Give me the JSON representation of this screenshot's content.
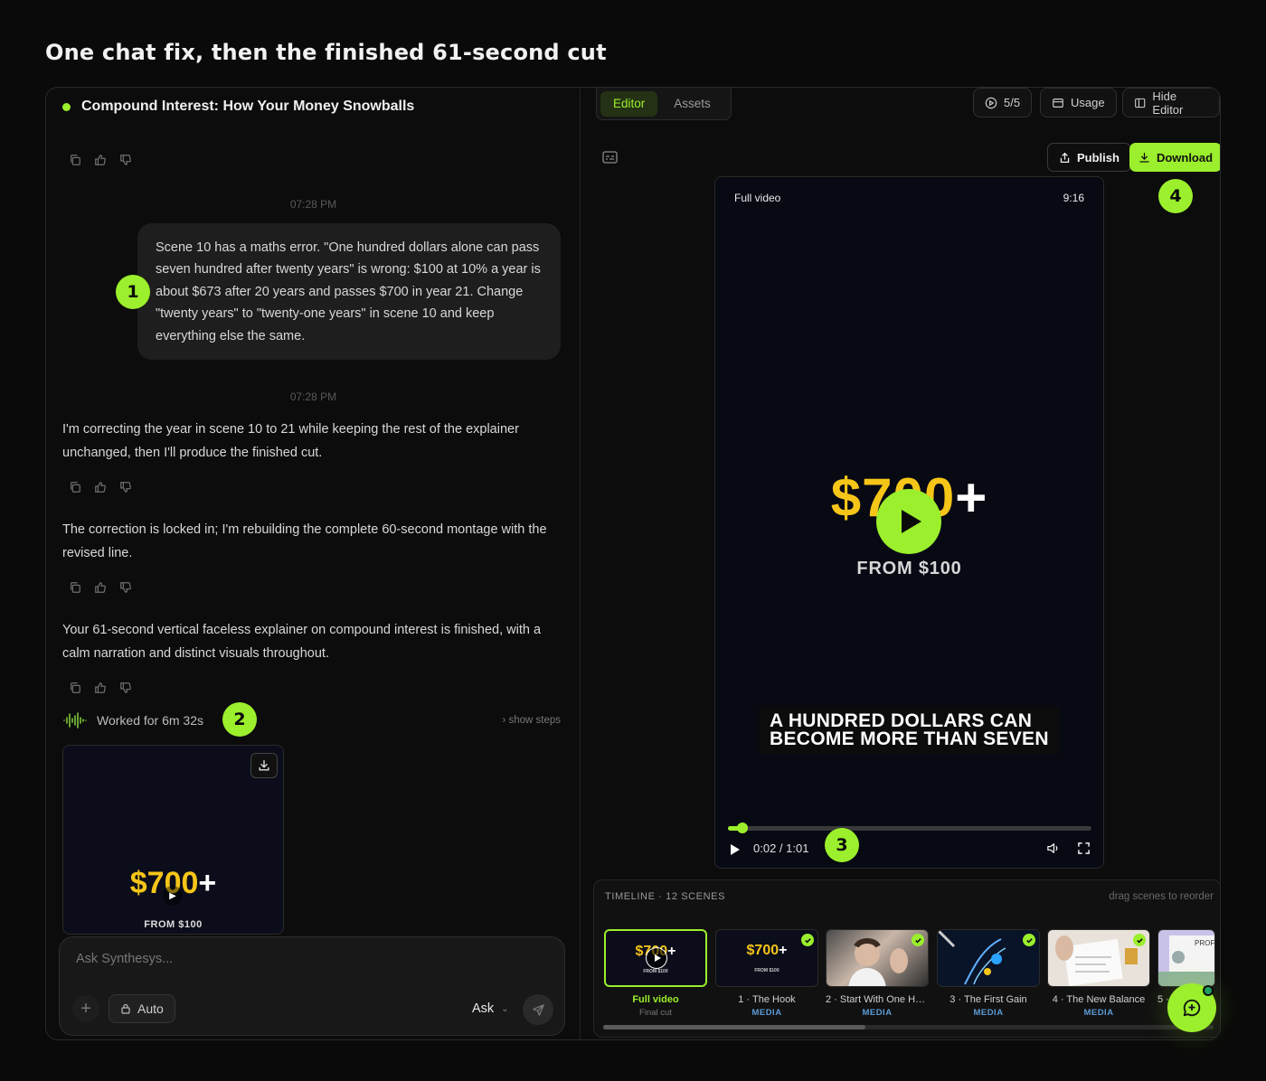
{
  "heading": "One chat fix, then the finished 61-second cut",
  "chat": {
    "project_title": "Compound Interest: How Your Money Snowballs",
    "timestamp_1": "07:28 PM",
    "user_message": "Scene 10 has a maths error. \"One hundred dollars alone can pass seven hundred after twenty years\" is wrong: $100 at 10% a year is about $673 after 20 years and passes $700 in year 21. Change \"twenty years\" to \"twenty-one years\" in scene 10 and keep everything else the same.",
    "timestamp_2": "07:28 PM",
    "assistant_1": "I'm correcting the year in scene 10 to 21 while keeping the rest of the explainer unchanged, then I'll produce the finished cut.",
    "assistant_2": "The correction is locked in; I'm rebuilding the complete 60-second montage with the revised line.",
    "assistant_3": "Your 61-second vertical faceless explainer on compound interest is finished, with a calm narration and distinct visuals throughout.",
    "worked_for": "Worked for 6m 32s",
    "show_steps": "› show steps",
    "thumb_amount": "$700",
    "thumb_plus": "+",
    "thumb_from": "FROM $100",
    "composer": {
      "placeholder": "Ask Synthesys...",
      "plus": "+",
      "auto_label": "Auto",
      "mode_label": "Ask"
    }
  },
  "badges": {
    "b1": "1",
    "b2": "2",
    "b3": "3",
    "b4": "4"
  },
  "editor": {
    "tabs": [
      "Editor",
      "Assets"
    ],
    "credits": "5/5",
    "usage_label": "Usage",
    "hide_editor_label": "Hide Editor",
    "publish_label": "Publish",
    "download_label": "Download",
    "player": {
      "label": "Full video",
      "ratio": "9:16",
      "amount": "$700",
      "plus": "+",
      "from": "FROM $100",
      "caption_line1": "A HUNDRED DOLLARS CAN",
      "caption_line2": "BECOME MORE THAN SEVEN",
      "time": "0:02 / 1:01",
      "progress": 0.04
    },
    "timeline": {
      "title": "TIMELINE · 12 SCENES",
      "hint": "drag scenes to reorder",
      "scenes": [
        {
          "name": "Full video",
          "tag": "Final cut"
        },
        {
          "name": "1 · The Hook",
          "tag": "MEDIA"
        },
        {
          "name": "2 · Start With One Hu...",
          "tag": "MEDIA"
        },
        {
          "name": "3 · The First Gain",
          "tag": "MEDIA"
        },
        {
          "name": "4 · The New Balance",
          "tag": "MEDIA"
        },
        {
          "name": "5 ·",
          "tag": ""
        }
      ],
      "mini_amount": "$700",
      "mini_plus": "+",
      "mini_from": "FROM $100",
      "scene5_text": "PROF"
    }
  },
  "colors": {
    "accent": "#9bef2c",
    "gold": "#f5c518",
    "media_tag": "#5b9bd5"
  }
}
